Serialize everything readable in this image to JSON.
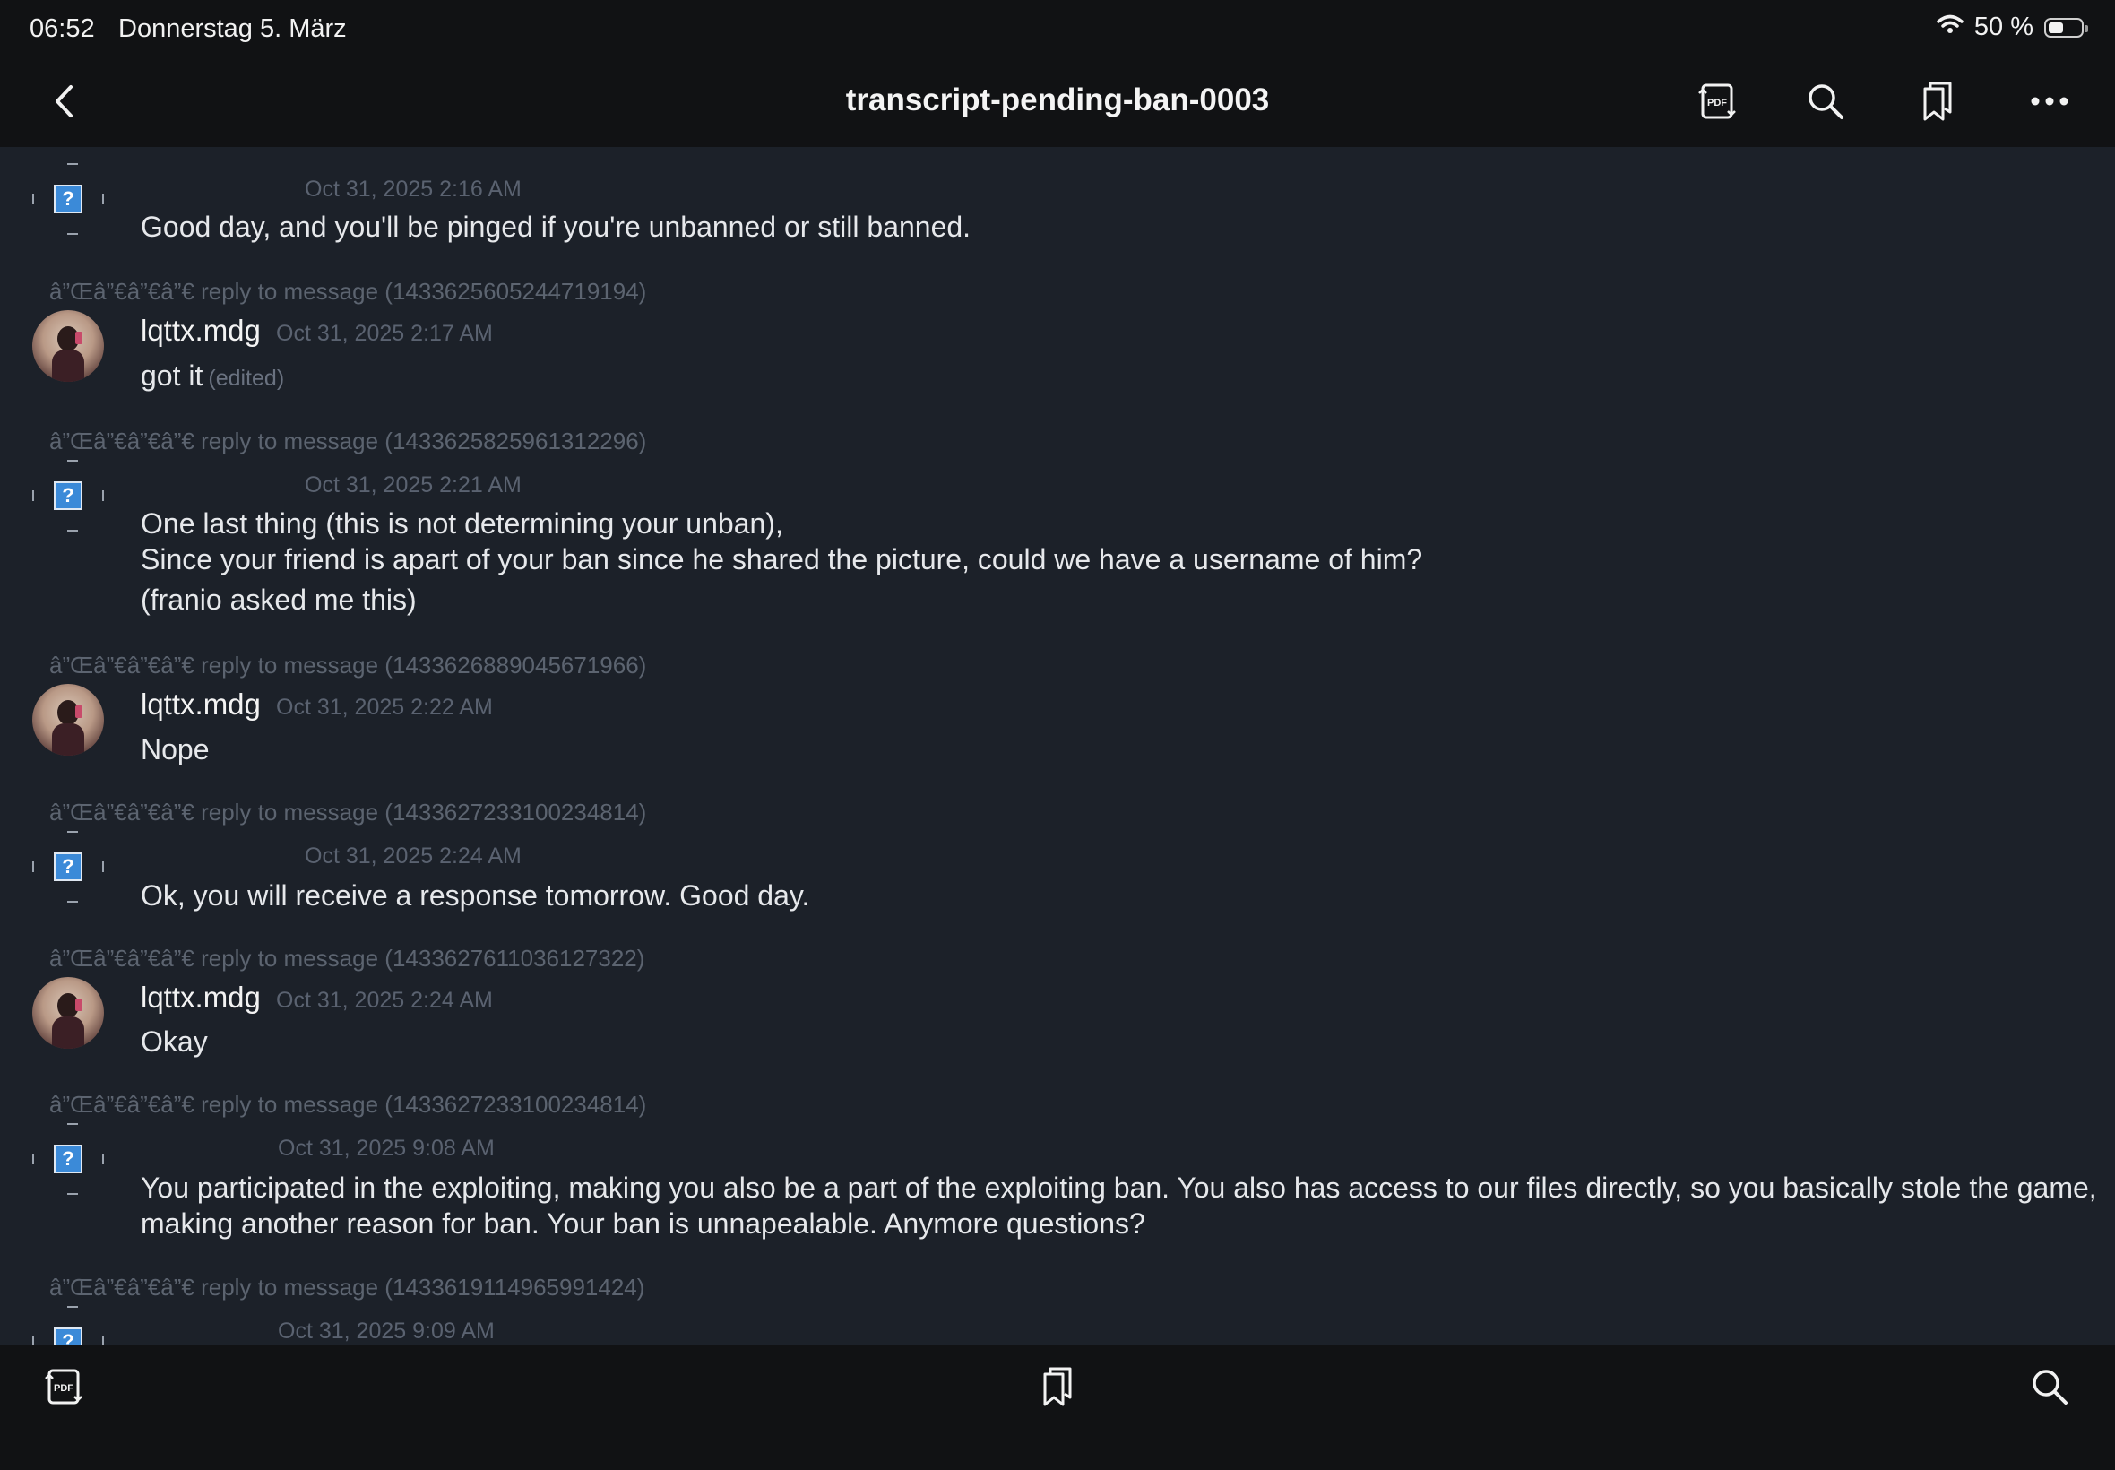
{
  "status_bar": {
    "time": "06:52",
    "date": "Donnerstag 5. März",
    "battery": "50 %"
  },
  "nav": {
    "title": "transcript-pending-ban-0003"
  },
  "messages": [
    {
      "timestamp": "Oct 31, 2025 2:16 AM",
      "lines": [
        "Good day, and you'll be pinged if you're unbanned or still banned."
      ]
    },
    {
      "reply": "â”Œâ”€â”€â”€ reply to message (1433625605244719194)",
      "author": "lqttx.mdg",
      "timestamp": "Oct 31, 2025 2:17 AM",
      "lines": [
        "got it"
      ],
      "edited": "(edited)"
    },
    {
      "reply": "â”Œâ”€â”€â”€ reply to message (1433625825961312296)",
      "timestamp": "Oct 31, 2025 2:21 AM",
      "lines": [
        "One last thing (this is not determining your unban),",
        "Since your friend is apart of your ban since he shared the picture, could we have a username of him?",
        "(franio asked me this)"
      ]
    },
    {
      "reply": "â”Œâ”€â”€â”€ reply to message (1433626889045671966)",
      "author": "lqttx.mdg",
      "timestamp": "Oct 31, 2025 2:22 AM",
      "lines": [
        "Nope"
      ]
    },
    {
      "reply": "â”Œâ”€â”€â”€ reply to message (1433627233100234814)",
      "timestamp": "Oct 31, 2025 2:24 AM",
      "lines": [
        "Ok, you will receive a response tomorrow. Good day."
      ]
    },
    {
      "reply": "â”Œâ”€â”€â”€ reply to message (1433627611036127322)",
      "author": "lqttx.mdg",
      "timestamp": "Oct 31, 2025 2:24 AM",
      "lines": [
        "Okay"
      ]
    },
    {
      "reply": "â”Œâ”€â”€â”€ reply to message (1433627233100234814)",
      "timestamp": "Oct 31, 2025 9:08 AM",
      "lines": [
        "You participated in the exploiting, making you also be a part of the exploiting ban. You also has access to our files directly, so you basically stole the game,",
        "making another reason for ban. Your ban is unnapealable. Anymore questions?"
      ]
    },
    {
      "reply": "â”Œâ”€â”€â”€ reply to message (1433619114965991424)",
      "timestamp": "Oct 31, 2025 9:09 AM"
    }
  ]
}
